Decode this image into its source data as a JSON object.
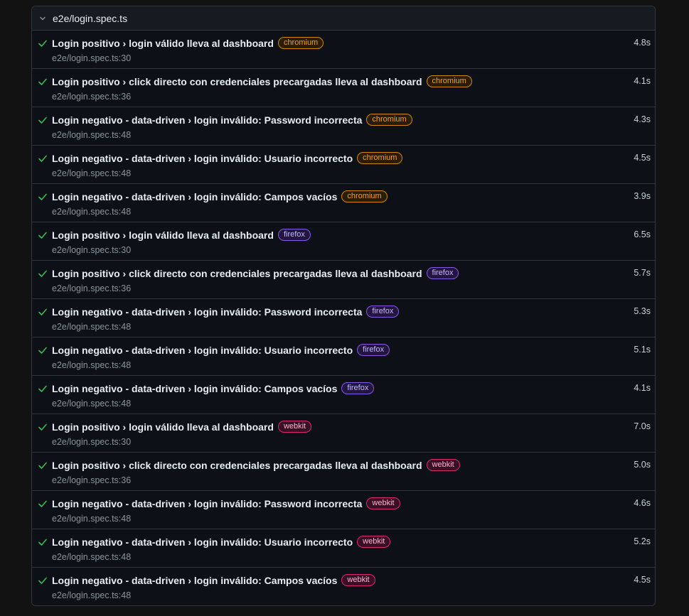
{
  "file": {
    "name": "e2e/login.spec.ts"
  },
  "colors": {
    "passed": "#3fb950",
    "chromium": "#d18616",
    "firefox": "#8957e5",
    "webkit": "#db2777"
  },
  "icons": {
    "expand": "chevron-down-icon",
    "status": "check-icon"
  },
  "tests": [
    {
      "title": "Login positivo › login válido lleva al dashboard",
      "project": "chromium",
      "location": "e2e/login.spec.ts:30",
      "duration": "4.8s"
    },
    {
      "title": "Login positivo › click directo con credenciales precargadas lleva al dashboard",
      "project": "chromium",
      "location": "e2e/login.spec.ts:36",
      "duration": "4.1s"
    },
    {
      "title": "Login negativo - data-driven › login inválido: Password incorrecta",
      "project": "chromium",
      "location": "e2e/login.spec.ts:48",
      "duration": "4.3s"
    },
    {
      "title": "Login negativo - data-driven › login inválido: Usuario incorrecto",
      "project": "chromium",
      "location": "e2e/login.spec.ts:48",
      "duration": "4.5s"
    },
    {
      "title": "Login negativo - data-driven › login inválido: Campos vacíos",
      "project": "chromium",
      "location": "e2e/login.spec.ts:48",
      "duration": "3.9s"
    },
    {
      "title": "Login positivo › login válido lleva al dashboard",
      "project": "firefox",
      "location": "e2e/login.spec.ts:30",
      "duration": "6.5s"
    },
    {
      "title": "Login positivo › click directo con credenciales precargadas lleva al dashboard",
      "project": "firefox",
      "location": "e2e/login.spec.ts:36",
      "duration": "5.7s"
    },
    {
      "title": "Login negativo - data-driven › login inválido: Password incorrecta",
      "project": "firefox",
      "location": "e2e/login.spec.ts:48",
      "duration": "5.3s"
    },
    {
      "title": "Login negativo - data-driven › login inválido: Usuario incorrecto",
      "project": "firefox",
      "location": "e2e/login.spec.ts:48",
      "duration": "5.1s"
    },
    {
      "title": "Login negativo - data-driven › login inválido: Campos vacíos",
      "project": "firefox",
      "location": "e2e/login.spec.ts:48",
      "duration": "4.1s"
    },
    {
      "title": "Login positivo › login válido lleva al dashboard",
      "project": "webkit",
      "location": "e2e/login.spec.ts:30",
      "duration": "7.0s"
    },
    {
      "title": "Login positivo › click directo con credenciales precargadas lleva al dashboard",
      "project": "webkit",
      "location": "e2e/login.spec.ts:36",
      "duration": "5.0s"
    },
    {
      "title": "Login negativo - data-driven › login inválido: Password incorrecta",
      "project": "webkit",
      "location": "e2e/login.spec.ts:48",
      "duration": "4.6s"
    },
    {
      "title": "Login negativo - data-driven › login inválido: Usuario incorrecto",
      "project": "webkit",
      "location": "e2e/login.spec.ts:48",
      "duration": "5.2s"
    },
    {
      "title": "Login negativo - data-driven › login inválido: Campos vacíos",
      "project": "webkit",
      "location": "e2e/login.spec.ts:48",
      "duration": "4.5s"
    }
  ]
}
